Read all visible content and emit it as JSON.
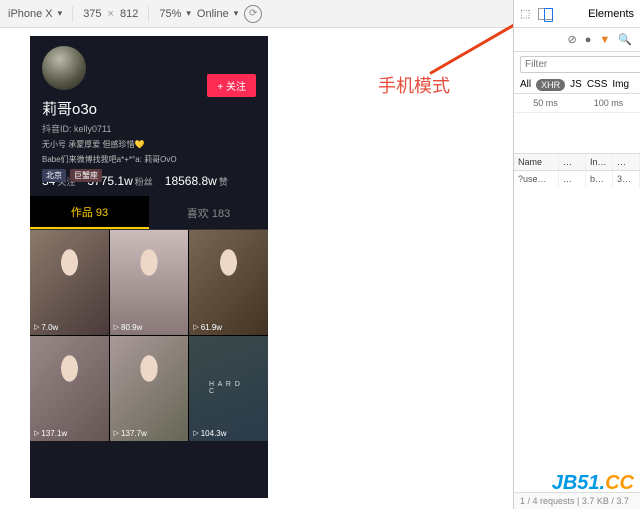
{
  "devbar": {
    "device": "iPhone X",
    "width": "375",
    "x": "×",
    "height": "812",
    "zoom": "75%",
    "online": "Online",
    "elements": "Elements"
  },
  "panel": {
    "filter_placeholder": "Filter",
    "filters": {
      "all": "All",
      "xhr": "XHR",
      "js": "JS",
      "css": "CSS",
      "img": "Img"
    },
    "wf": {
      "t1": "50 ms",
      "t2": "100 ms"
    },
    "cols": {
      "name": "Name",
      "st": "…",
      "in": "In…",
      "sz": "…"
    },
    "row": {
      "name": "?use…",
      "st": "…",
      "in": "b…",
      "sz": "3…"
    },
    "status": "1 / 4 requests | 3.7 KB / 3.7"
  },
  "annotation": "手机模式",
  "watermark": {
    "a": "JB51.",
    "b": "CC"
  },
  "profile": {
    "name": "莉哥o3o",
    "id_label": "抖音ID:",
    "id": "kelly0711",
    "bio1": "无小号 承蒙厚爱 但感珍惜💛",
    "bio2": "Babe们来微博找我吧a*+*°a: 莉哥OvO",
    "follow": "+ 关注",
    "tag_loc": "北京",
    "tag_star": "巨蟹座"
  },
  "stats": {
    "follow_n": "34",
    "follow_l": "关注",
    "fans_n": "3775.1w",
    "fans_l": "粉丝",
    "like_n": "18568.8w",
    "like_l": "赞"
  },
  "tabs": {
    "works": "作品 93",
    "likes": "喜欢 183"
  },
  "videos": [
    {
      "v": "7.0w"
    },
    {
      "v": "80.9w"
    },
    {
      "v": "61.9w"
    },
    {
      "v": "137.1w"
    },
    {
      "v": "137.7w"
    },
    {
      "v": "104.3w"
    }
  ],
  "hardc": "H A R D C"
}
